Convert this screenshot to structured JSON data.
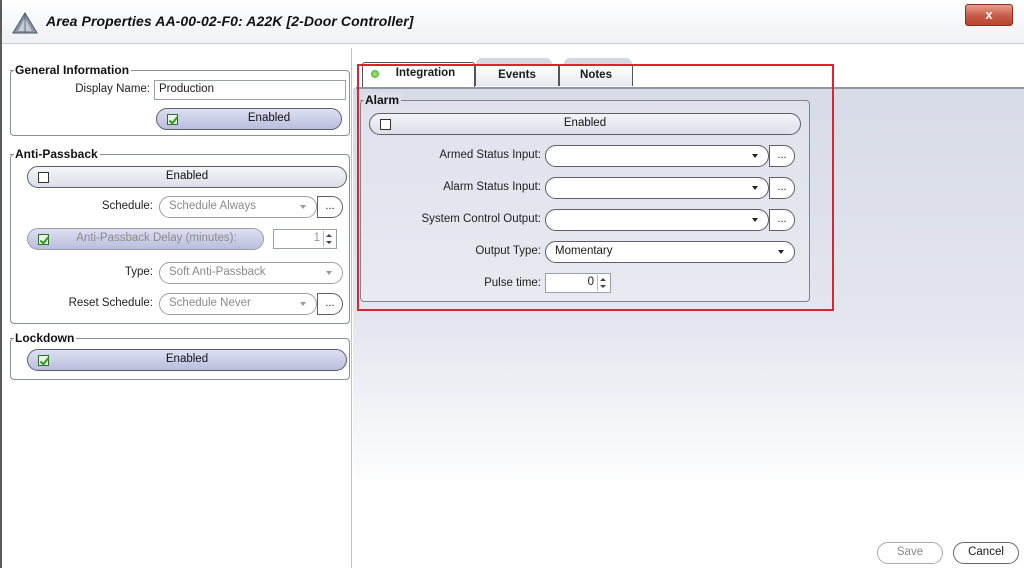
{
  "window": {
    "title": "Area Properties  AA-00-02-F0: A22K [2-Door Controller]",
    "close_label": "x",
    "accent_close": "#c75a45",
    "highlight_color": "#d9262e"
  },
  "general": {
    "legend": "General Information",
    "display_name_label": "Display Name:",
    "display_name_value": "Production",
    "enabled_label": "Enabled",
    "enabled_checked": true
  },
  "anti_passback": {
    "legend": "Anti-Passback",
    "enabled_label": "Enabled",
    "enabled_checked": false,
    "schedule_label": "Schedule:",
    "schedule_value": "Schedule Always",
    "ellipsis": "...",
    "delay_label": "Anti-Passback Delay (minutes):",
    "delay_checked": true,
    "delay_value": "1",
    "type_label": "Type:",
    "type_value": "Soft Anti-Passback",
    "reset_schedule_label": "Reset Schedule:",
    "reset_schedule_value": "Schedule Never"
  },
  "lockdown": {
    "legend": "Lockdown",
    "enabled_label": "Enabled",
    "enabled_checked": true
  },
  "tabs": [
    {
      "label": "Integration",
      "active": true
    },
    {
      "label": "Events",
      "active": false
    },
    {
      "label": "Notes",
      "active": false
    }
  ],
  "alarm": {
    "legend": "Alarm",
    "enabled_label": "Enabled",
    "enabled_checked": false,
    "armed_status_label": "Armed Status Input:",
    "armed_status_value": "",
    "alarm_status_label": "Alarm Status Input:",
    "alarm_status_value": "",
    "system_control_label": "System Control Output:",
    "system_control_value": "",
    "output_type_label": "Output Type:",
    "output_type_value": "Momentary",
    "pulse_time_label": "Pulse time:",
    "pulse_time_value": "0",
    "ellipsis": "..."
  },
  "footer": {
    "save_label": "Save",
    "cancel_label": "Cancel"
  }
}
